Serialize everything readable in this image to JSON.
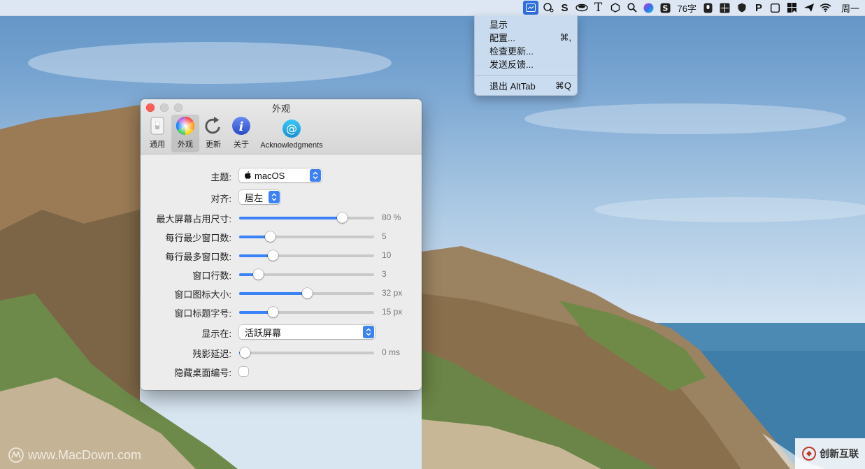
{
  "menubar": {
    "input_method": "76字",
    "clock": "周一"
  },
  "menu": {
    "items": [
      {
        "label": "显示",
        "shortcut": ""
      },
      {
        "label": "配置...",
        "shortcut": "⌘,"
      },
      {
        "label": "检查更新...",
        "shortcut": ""
      },
      {
        "label": "发送反馈...",
        "shortcut": ""
      },
      {
        "label": "退出 AltTab",
        "shortcut": "⌘Q"
      }
    ]
  },
  "window": {
    "title": "外观",
    "tabs": [
      {
        "label": "通用",
        "icon": "switch-icon"
      },
      {
        "label": "外观",
        "icon": "color-wheel-icon"
      },
      {
        "label": "更新",
        "icon": "refresh-icon"
      },
      {
        "label": "关于",
        "icon": "info-icon"
      },
      {
        "label": "Acknowledgments",
        "icon": "at-sign-icon"
      }
    ],
    "selected_tab": "外观"
  },
  "settings": {
    "theme": {
      "label": "主题:",
      "value": "macOS"
    },
    "align": {
      "label": "对齐:",
      "value": "居左"
    },
    "max_screen": {
      "label": "最大屏幕占用尺寸:",
      "value": "80 %",
      "fraction": 0.76
    },
    "min_per_row": {
      "label": "每行最少窗口数:",
      "value": "5",
      "fraction": 0.23
    },
    "max_per_row": {
      "label": "每行最多窗口数:",
      "value": "10",
      "fraction": 0.25
    },
    "rows": {
      "label": "窗口行数:",
      "value": "3",
      "fraction": 0.14
    },
    "icon_size": {
      "label": "窗口图标大小:",
      "value": "32 px",
      "fraction": 0.5
    },
    "title_font": {
      "label": "窗口标题字号:",
      "value": "15 px",
      "fraction": 0.25
    },
    "show_on": {
      "label": "显示在:",
      "value": "活跃屏幕"
    },
    "delay": {
      "label": "残影延迟:",
      "value": "0 ms",
      "fraction": 0.04
    },
    "hide_space": {
      "label": "隐藏桌面编号:",
      "checked": false
    }
  },
  "watermarks": {
    "left": "www.MacDown.com",
    "right": "创新互联"
  },
  "colors": {
    "accent": "#3b82f6",
    "close": "#fe5f57"
  }
}
